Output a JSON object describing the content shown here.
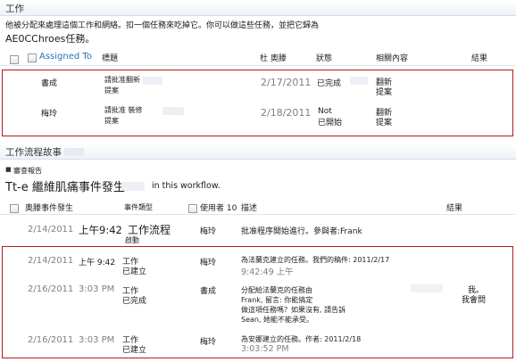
{
  "tasks_section": {
    "title": "工作",
    "description_line1": "他被分配來處理這個工作和網絡。扣一個任務來吃掉它。你可以做這些任務，並把它歸為",
    "description_line2": "AE0CChroes任務。",
    "columns": {
      "assigned_to": "Assigned To",
      "title": "標題",
      "due_date": "杜 奧滕",
      "status": "狀態",
      "related": "相關內容",
      "outcome": "結果"
    },
    "rows": [
      {
        "assigned_to": "書成",
        "title_line1": "請批准翻新",
        "title_line2": "提案",
        "due_date": "2/17/2011",
        "status_line1": "已完成",
        "status_line2": "",
        "related_line1": "翻新",
        "related_line2": "提案"
      },
      {
        "assigned_to": "梅玲",
        "title_line1": "請批准 裝修",
        "title_line2": "提案",
        "due_date": "2/18/2011",
        "status_line1": "Not",
        "status_line2": "已開始",
        "related_line1": "翻新",
        "related_line2": "提案"
      }
    ]
  },
  "history_section": {
    "title": "工作流程故事",
    "report_link": "審查報告",
    "headline_part1": "Tt-e 繼維肌痛事件發生",
    "headline_part2": "in this workflow.",
    "columns": {
      "date_occurred": "奥滕事件發生",
      "event_type": "事件類型",
      "user_id": "使用者 10",
      "description": "描述",
      "outcome": "結果"
    },
    "rows": [
      {
        "date": "2/14/2011",
        "time": "上午9:42",
        "event_line1": "工作流程",
        "event_line2": "啟動",
        "user": "梅玲",
        "desc_line1": "批准程序開始進行。參與者:Frank",
        "desc_line2": "",
        "desc_line3": "",
        "desc_line4": "",
        "outcome_line1": "",
        "outcome_line2": ""
      },
      {
        "date": "2/14/2011",
        "time": "上午 9:42",
        "event_line1": "工作",
        "event_line2": "已建立",
        "user": "梅玲",
        "desc_line1": "為法蘭克建立的任務。我們的稿件: 2011/2/17",
        "desc_line2": "9:42:49 上午",
        "desc_line3": "",
        "desc_line4": "",
        "outcome_line1": "",
        "outcome_line2": ""
      },
      {
        "date": "2/16/2011",
        "time": "3:03 PM",
        "event_line1": "工作",
        "event_line2": "已完成",
        "user": "書成",
        "desc_line1": "分配給法蘭克的任務由",
        "desc_line2": "Frank, 留言: 你能搞定",
        "desc_line3": "做這項任務嗎？如果沒有, 請告訴",
        "desc_line4": "Sean, 她能不能承受。",
        "outcome_line1": "我。",
        "outcome_line2": "我會問"
      },
      {
        "date": "2/16/2011",
        "time": "3:03 PM",
        "event_line1": "工作",
        "event_line2": "已建立",
        "user": "梅玲",
        "desc_line1": "為安娜建立的任務。作者: 2011/2/18",
        "desc_line2": "3:03:52 PM",
        "desc_line3": "",
        "desc_line4": "",
        "outcome_line1": "",
        "outcome_line2": ""
      }
    ]
  },
  "colors": {
    "highlight_border": "#b31b1b",
    "link_blue": "#2a6ebb",
    "header_gradient": "#eef3f8"
  }
}
